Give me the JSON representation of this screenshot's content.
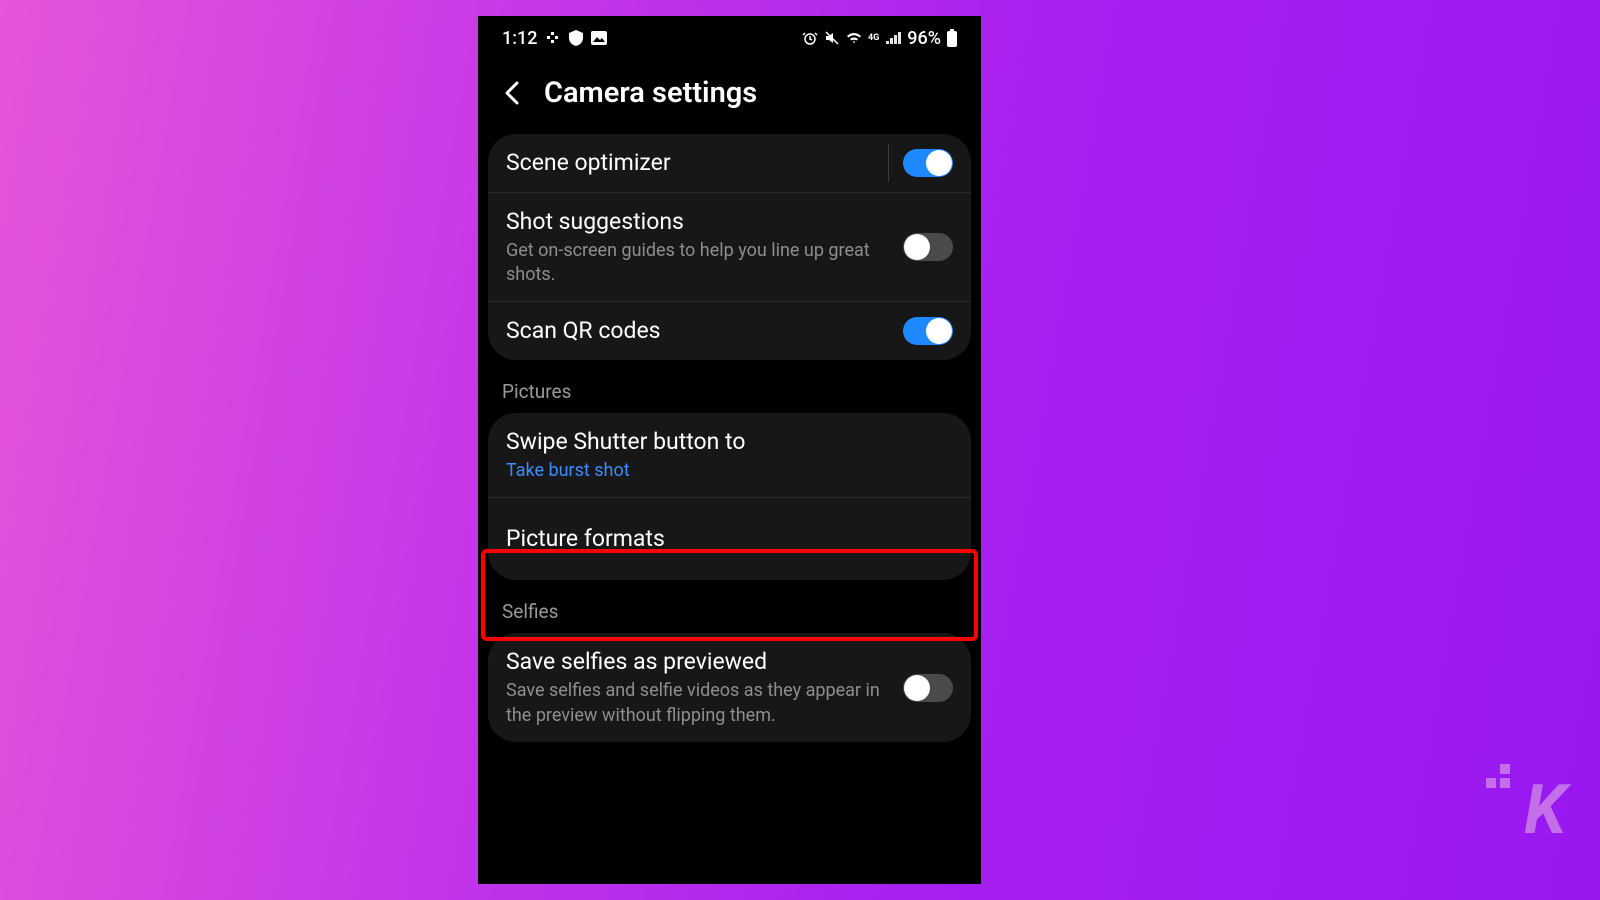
{
  "statusbar": {
    "time": "1:12",
    "battery_pct": "96%",
    "network_label": "4G"
  },
  "header": {
    "title": "Camera settings"
  },
  "group1": {
    "scene_optimizer": {
      "title": "Scene optimizer",
      "on": true
    },
    "shot_suggestions": {
      "title": "Shot suggestions",
      "sub": "Get on-screen guides to help you line up great shots.",
      "on": false
    },
    "scan_qr": {
      "title": "Scan QR codes",
      "on": true
    }
  },
  "sections": {
    "pictures": "Pictures",
    "selfies": "Selfies"
  },
  "group2": {
    "swipe_shutter": {
      "title": "Swipe Shutter button to",
      "sub": "Take burst shot"
    },
    "picture_formats": {
      "title": "Picture formats"
    }
  },
  "group3": {
    "save_selfies": {
      "title": "Save selfies as previewed",
      "sub": "Save selfies and selfie videos as they appear in the preview without flipping them.",
      "on": false
    }
  },
  "watermark": "K"
}
